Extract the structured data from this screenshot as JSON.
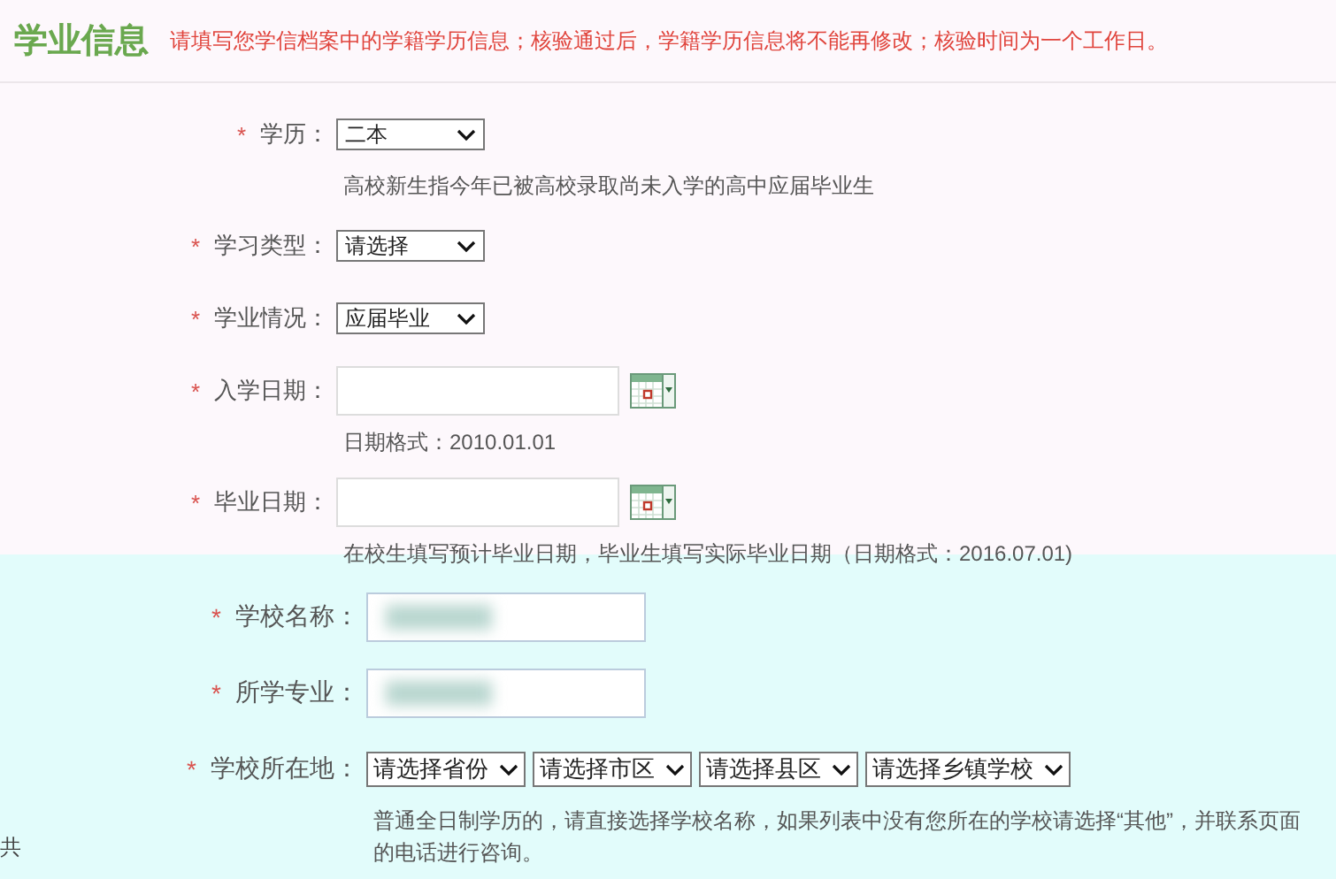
{
  "header": {
    "title": "学业信息",
    "notice": "请填写您学信档案中的学籍学历信息；核验通过后，学籍学历信息将不能再修改；核验时间为一个工作日。"
  },
  "section_1": {
    "rows": [
      {
        "kind": "select",
        "label": "学历：",
        "required_mark": "*",
        "value": "二本",
        "hint": "高校新生指今年已被高校录取尚未入学的高中应届毕业生"
      },
      {
        "kind": "select",
        "label": "学习类型：",
        "required_mark": "*",
        "value": "请选择"
      },
      {
        "kind": "select",
        "label": "学业情况：",
        "required_mark": "*",
        "value": "应届毕业"
      },
      {
        "kind": "date",
        "label": "入学日期：",
        "required_mark": "*",
        "hint": "日期格式：2010.01.01"
      },
      {
        "kind": "date",
        "label": "毕业日期：",
        "required_mark": "*",
        "hint": "在校生填写预计毕业日期，毕业生填写实际毕业日期（日期格式：2016.07.01)"
      }
    ]
  },
  "section_2": {
    "rows": [
      {
        "kind": "text",
        "label": "学校名称：",
        "required_mark": "*"
      },
      {
        "kind": "text",
        "label": "所学专业：",
        "required_mark": "*"
      },
      {
        "kind": "selects",
        "label": "学校所在地：",
        "required_mark": "*",
        "options": [
          "请选择省份",
          "请选择市区",
          "请选择县区",
          "请选择乡镇学校"
        ],
        "hint_lines": [
          "普通全日制学历的，请直接选择学校名称，如果列表中没有您所在的学校请选择“其他”，并联系页面",
          "的电话进行咨询。"
        ]
      }
    ]
  },
  "edge_text": "共"
}
